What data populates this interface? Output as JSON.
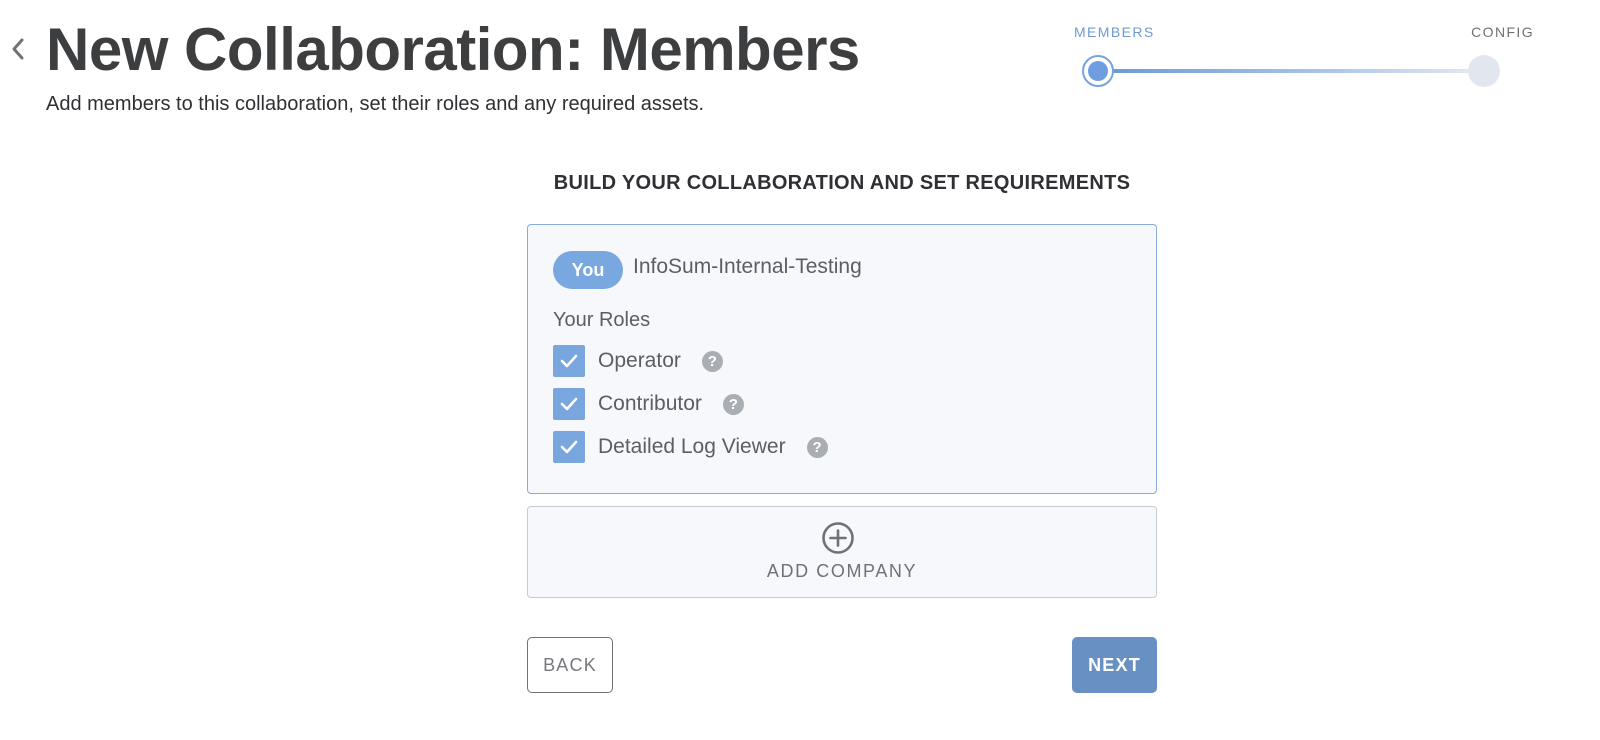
{
  "header": {
    "title": "New Collaboration: Members",
    "subtitle": "Add members to this collaboration, set their roles and any required assets."
  },
  "stepper": {
    "steps": [
      {
        "label": "MEMBERS",
        "state": "active"
      },
      {
        "label": "CONFIG",
        "state": "upcoming"
      }
    ]
  },
  "main": {
    "heading": "BUILD YOUR COLLABORATION AND SET REQUIREMENTS",
    "member_card": {
      "badge": "You",
      "company": "InfoSum-Internal-Testing",
      "roles_label": "Your Roles",
      "roles": [
        {
          "label": "Operator",
          "checked": true,
          "help_icon": "question-circle-icon"
        },
        {
          "label": "Contributor",
          "checked": true,
          "help_icon": "question-circle-icon"
        },
        {
          "label": "Detailed Log Viewer",
          "checked": true,
          "help_icon": "question-circle-icon"
        }
      ]
    },
    "add_company": {
      "label": "ADD COMPANY",
      "icon": "plus-circle-icon"
    }
  },
  "footer": {
    "back_label": "BACK",
    "next_label": "NEXT"
  },
  "colors": {
    "accent": "#79a7df",
    "primary_button": "#6990c2",
    "card_border_active": "#86ace2",
    "help_icon": "#a9adb4"
  }
}
